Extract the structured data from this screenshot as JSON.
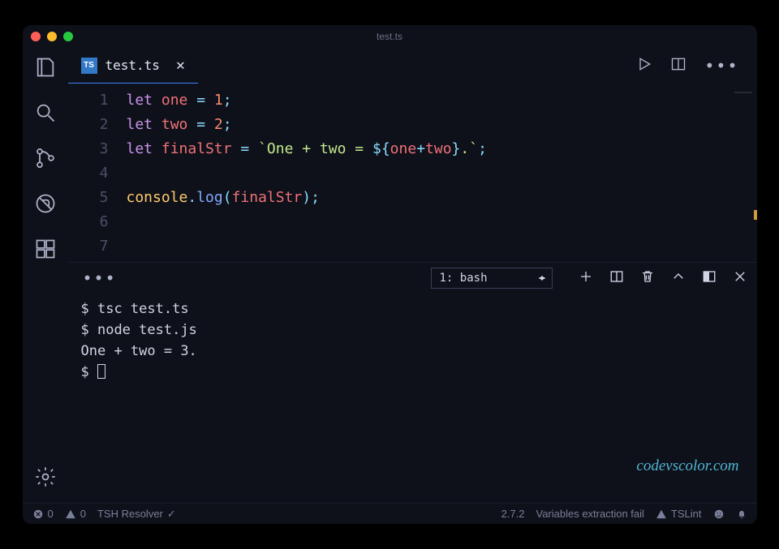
{
  "window": {
    "title": "test.ts"
  },
  "tab": {
    "filename": "test.ts",
    "lang_badge": "TS"
  },
  "code": {
    "lines": [
      {
        "n": 1,
        "tokens": [
          [
            "kw",
            "let"
          ],
          [
            "",
            " "
          ],
          [
            "var",
            "one"
          ],
          [
            "",
            " "
          ],
          [
            "op",
            "="
          ],
          [
            "",
            " "
          ],
          [
            "num",
            "1"
          ],
          [
            "op",
            ";"
          ]
        ]
      },
      {
        "n": 2,
        "tokens": [
          [
            "kw",
            "let"
          ],
          [
            "",
            " "
          ],
          [
            "var",
            "two"
          ],
          [
            "",
            " "
          ],
          [
            "op",
            "="
          ],
          [
            "",
            " "
          ],
          [
            "num",
            "2"
          ],
          [
            "op",
            ";"
          ]
        ]
      },
      {
        "n": 3,
        "tokens": [
          [
            "kw",
            "let"
          ],
          [
            "",
            " "
          ],
          [
            "var",
            "finalStr"
          ],
          [
            "",
            " "
          ],
          [
            "op",
            "="
          ],
          [
            "",
            " "
          ],
          [
            "str",
            "`One + two = "
          ],
          [
            "interp",
            "${"
          ],
          [
            "var",
            "one"
          ],
          [
            "op",
            "+"
          ],
          [
            "var",
            "two"
          ],
          [
            "interp",
            "}"
          ],
          [
            "str",
            ".`"
          ],
          [
            "op",
            ";"
          ]
        ]
      },
      {
        "n": 4,
        "tokens": []
      },
      {
        "n": 5,
        "tokens": [
          [
            "obj",
            "console"
          ],
          [
            "op",
            "."
          ],
          [
            "fn",
            "log"
          ],
          [
            "op",
            "("
          ],
          [
            "var",
            "finalStr"
          ],
          [
            "op",
            ")"
          ],
          [
            "op",
            ";"
          ]
        ]
      },
      {
        "n": 6,
        "tokens": []
      },
      {
        "n": 7,
        "tokens": []
      }
    ]
  },
  "terminal": {
    "selector_label": "1: bash",
    "lines": [
      "$ tsc test.ts",
      "$ node test.js",
      "One + two = 3.",
      "$ "
    ]
  },
  "statusbar": {
    "errors": "0",
    "warnings": "0",
    "resolver": "TSH Resolver",
    "prettier_version": "2.7.2",
    "message": "Variables extraction fail",
    "tslint": "TSLint"
  },
  "watermark": "codevscolor.com"
}
